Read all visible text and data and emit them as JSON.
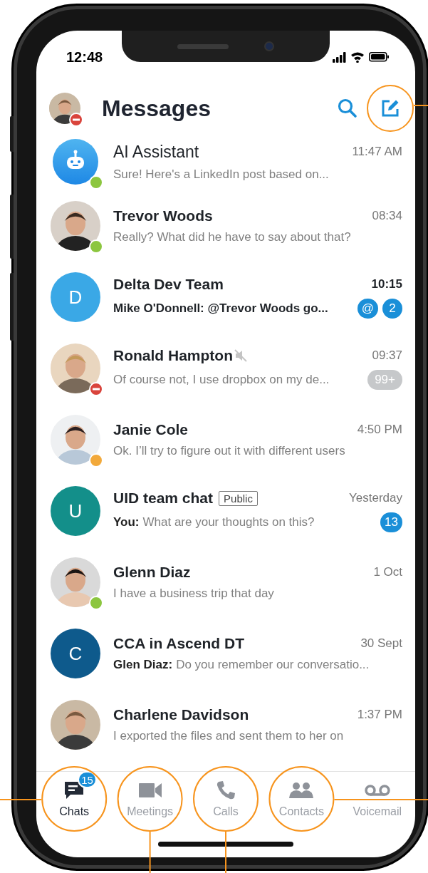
{
  "status_bar": {
    "time": "12:48"
  },
  "header": {
    "title": "Messages",
    "user": {
      "color": "#d9443c",
      "do_not_disturb": true
    }
  },
  "chats": [
    {
      "kind": "bot",
      "name": "AI Assistant",
      "time": "11:47 AM",
      "preview": "Sure! Here's a LinkedIn post based on...",
      "status": {
        "color": "#8cc63f",
        "do_not_disturb": false
      },
      "unread": false
    },
    {
      "kind": "person",
      "name": "Trevor Woods",
      "time": "08:34",
      "preview": "Really? What did he have to say about that?",
      "status": {
        "color": "#8cc63f",
        "do_not_disturb": false
      },
      "unread": false
    },
    {
      "kind": "group",
      "initial": "D",
      "color": "#3aa8e6",
      "name": "Delta Dev Team",
      "time": "10:15",
      "preview": "Mike O'Donnell: @Trevor Woods go...",
      "unread": true,
      "badges": [
        {
          "kind": "mention",
          "text": "@"
        },
        {
          "kind": "count",
          "text": "2"
        }
      ]
    },
    {
      "kind": "person",
      "name": "Ronald Hampton",
      "muted": true,
      "time": "09:37",
      "preview": "Of course not, I use dropbox on my de...",
      "status": {
        "color": "#d9443c",
        "do_not_disturb": true
      },
      "unread": false,
      "badges": [
        {
          "kind": "muted",
          "text": "99+"
        }
      ]
    },
    {
      "kind": "person",
      "name": "Janie Cole",
      "time": "4:50 PM",
      "preview": "Ok. I’ll try to figure out it with different users",
      "status": {
        "color": "#f2a93b",
        "do_not_disturb": false
      },
      "unread": false
    },
    {
      "kind": "group",
      "initial": "U",
      "color": "#138f8a",
      "name": "UID team chat",
      "tag": "Public",
      "time": "Yesterday",
      "sender": "You:",
      "preview": "What are your thoughts on this?",
      "unread": false,
      "badges": [
        {
          "kind": "count",
          "text": "13"
        }
      ]
    },
    {
      "kind": "person",
      "name": "Glenn Diaz",
      "time": "1 Oct",
      "preview": "I have a business trip that day",
      "status": {
        "color": "#8cc63f",
        "do_not_disturb": false
      },
      "unread": false
    },
    {
      "kind": "group",
      "initial": "C",
      "color": "#0e5a8c",
      "name": "CCA in Ascend DT",
      "time": "30 Sept",
      "sender": "Glen Diaz:",
      "preview": "Do you remember our conversatio...",
      "unread": false
    },
    {
      "kind": "person",
      "name": "Charlene Davidson",
      "time": "1:37 PM",
      "preview": "I exported the files and sent them to her on",
      "unread": false
    }
  ],
  "tabs": [
    {
      "label": "Chats",
      "selected": true,
      "badge": "15"
    },
    {
      "label": "Meetings",
      "selected": false
    },
    {
      "label": "Calls",
      "selected": false
    },
    {
      "label": "Contacts",
      "selected": false
    },
    {
      "label": "Voicemail",
      "selected": false
    }
  ]
}
